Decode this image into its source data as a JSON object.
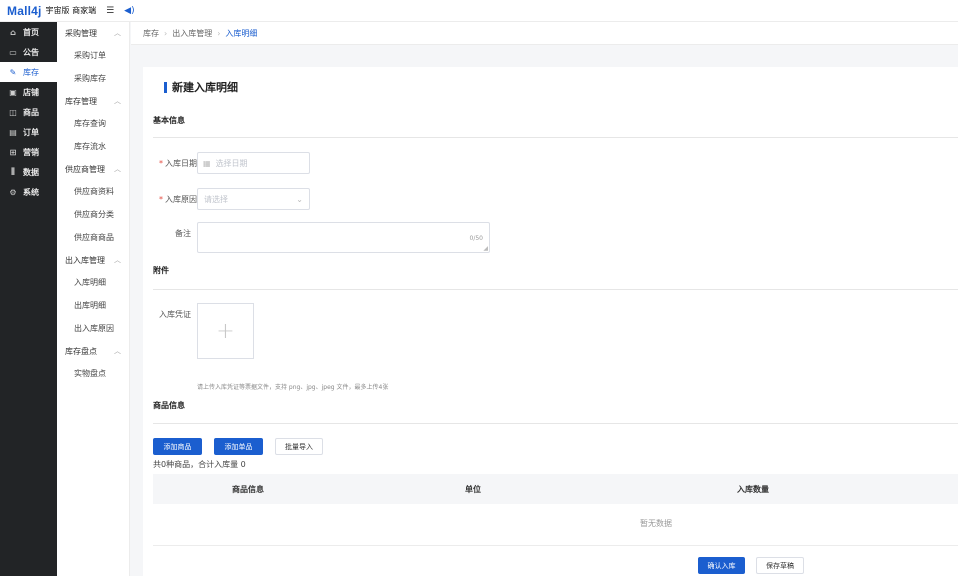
{
  "topbar": {
    "logo": "Mall4j",
    "subtitle": "宇宙版 商家端",
    "menu_icon": "menu-fold-icon",
    "sound_icon": "speaker-icon"
  },
  "primary_nav": [
    {
      "icon": "home-icon",
      "glyph": "⌂",
      "label": "首页"
    },
    {
      "icon": "notice-icon",
      "glyph": "▭",
      "label": "公告"
    },
    {
      "icon": "edit-icon",
      "glyph": "✎",
      "label": "库存",
      "active": true
    },
    {
      "icon": "store-icon",
      "glyph": "▣",
      "label": "店铺"
    },
    {
      "icon": "goods-icon",
      "glyph": "◫",
      "label": "商品"
    },
    {
      "icon": "order-icon",
      "glyph": "▤",
      "label": "订单"
    },
    {
      "icon": "gift-icon",
      "glyph": "⊞",
      "label": "营销"
    },
    {
      "icon": "chart-icon",
      "glyph": "⫼",
      "label": "数据"
    },
    {
      "icon": "settings-icon",
      "glyph": "⚙",
      "label": "系统"
    }
  ],
  "secondary_nav": {
    "groups": [
      {
        "label": "采购管理",
        "items": [
          "采购订单",
          "采购库存"
        ]
      },
      {
        "label": "库存管理",
        "items": [
          "库存查询",
          "库存流水"
        ]
      },
      {
        "label": "供应商管理",
        "items": [
          "供应商资料",
          "供应商分类",
          "供应商商品"
        ]
      },
      {
        "label": "出入库管理",
        "items": [
          "入库明细",
          "出库明细",
          "出入库原因"
        ]
      },
      {
        "label": "库存盘点",
        "items": [
          "实物盘点"
        ]
      }
    ]
  },
  "breadcrumb": [
    "库存",
    "出入库管理",
    "入库明细"
  ],
  "page": {
    "title": "新建入库明细",
    "basic_section": "基本信息",
    "date_label": "入库日期",
    "date_placeholder": "选择日期",
    "reason_label": "入库原因",
    "reason_placeholder": "请选择",
    "remark_label": "备注",
    "remark_count": "0/50",
    "attach_section": "附件",
    "voucher_label": "入库凭证",
    "upload_plus": "+",
    "upload_hint": "请上传入库凭证等票据文件，支持 png、jpg、jpeg 文件，最多上传4张",
    "goods_section": "商品信息",
    "add_goods": "添加商品",
    "add_single": "添加单品",
    "batch_import": "批量导入",
    "summary": "共0种商品，合计入库量 0",
    "table_headers": [
      "商品信息",
      "单位",
      "入库数量"
    ],
    "empty_text": "暂无数据",
    "confirm_button": "确认入库",
    "save_draft_button": "保存草稿"
  }
}
